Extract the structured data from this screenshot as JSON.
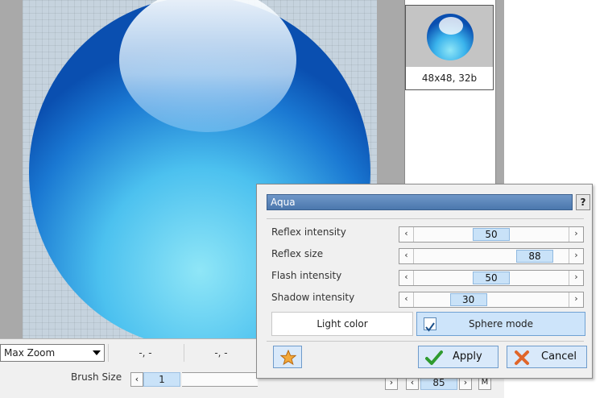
{
  "preview": {
    "thumbnail_label": "48x48, 32b"
  },
  "toolbar": {
    "zoom_mode": "Max Zoom",
    "coord1": "-, -",
    "coord2": "-, -",
    "brush_label": "Brush Size",
    "brush_value": "1",
    "zoom_value": "85",
    "m_label": "M"
  },
  "dialog": {
    "preset_name": "Aqua",
    "help_label": "?",
    "params": [
      {
        "label": "Reflex intensity",
        "value": "50",
        "level": 50
      },
      {
        "label": "Reflex size",
        "value": "88",
        "level": 88
      },
      {
        "label": "Flash intensity",
        "value": "50",
        "level": 50
      },
      {
        "label": "Shadow intensity",
        "value": "30",
        "level": 30
      }
    ],
    "light_color_label": "Light color",
    "sphere_mode_label": "Sphere mode",
    "sphere_mode_checked": true,
    "apply_label": "Apply",
    "cancel_label": "Cancel"
  },
  "colors": {
    "sphere_dark": "#0a4fb0",
    "sphere_light": "#8fe0f4",
    "accent": "#4b77ad",
    "selection": "#c9e2f8"
  },
  "icons": {
    "fav": "star-icon",
    "apply": "checkmark-icon",
    "cancel": "x-icon",
    "help": "help-icon",
    "zoom_dropdown": "chevron-down-icon"
  }
}
